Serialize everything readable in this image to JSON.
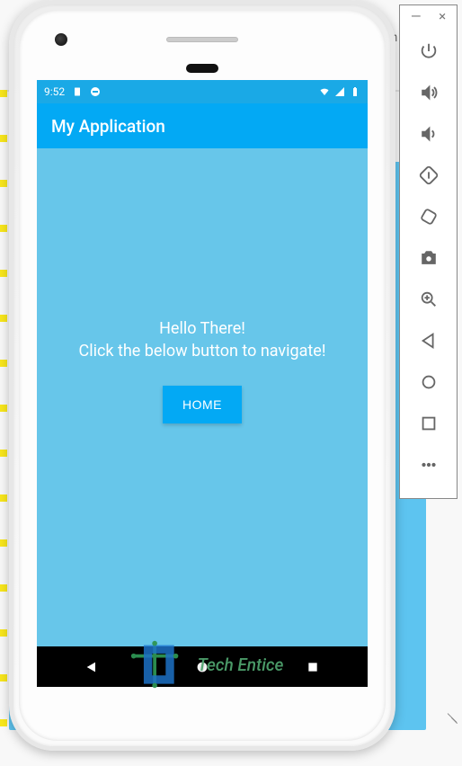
{
  "emulator": {
    "window_controls": {
      "minimize": "—",
      "close": "×"
    },
    "tools": [
      {
        "name": "power",
        "label": "Power"
      },
      {
        "name": "volume_up",
        "label": "Volume up"
      },
      {
        "name": "volume_down",
        "label": "Volume down"
      },
      {
        "name": "rotate_left",
        "label": "Rotate left"
      },
      {
        "name": "rotate_right",
        "label": "Rotate right"
      },
      {
        "name": "camera",
        "label": "Take screenshot"
      },
      {
        "name": "zoom",
        "label": "Zoom"
      },
      {
        "name": "back",
        "label": "Back"
      },
      {
        "name": "home",
        "label": "Home"
      },
      {
        "name": "overview",
        "label": "Overview"
      },
      {
        "name": "more",
        "label": "More"
      }
    ]
  },
  "bg_hint_char": "m",
  "phone": {
    "status": {
      "time": "9:52",
      "signals": {
        "wifi": true,
        "cell": true,
        "battery": true
      }
    },
    "app": {
      "title": "My Application",
      "hello_text": "Hello There!",
      "instruction_text": "Click the below button to navigate!",
      "button_label": "HOME"
    },
    "nav_buttons": [
      "back",
      "home",
      "recents"
    ]
  },
  "watermark": {
    "text": "Tech Entice"
  }
}
